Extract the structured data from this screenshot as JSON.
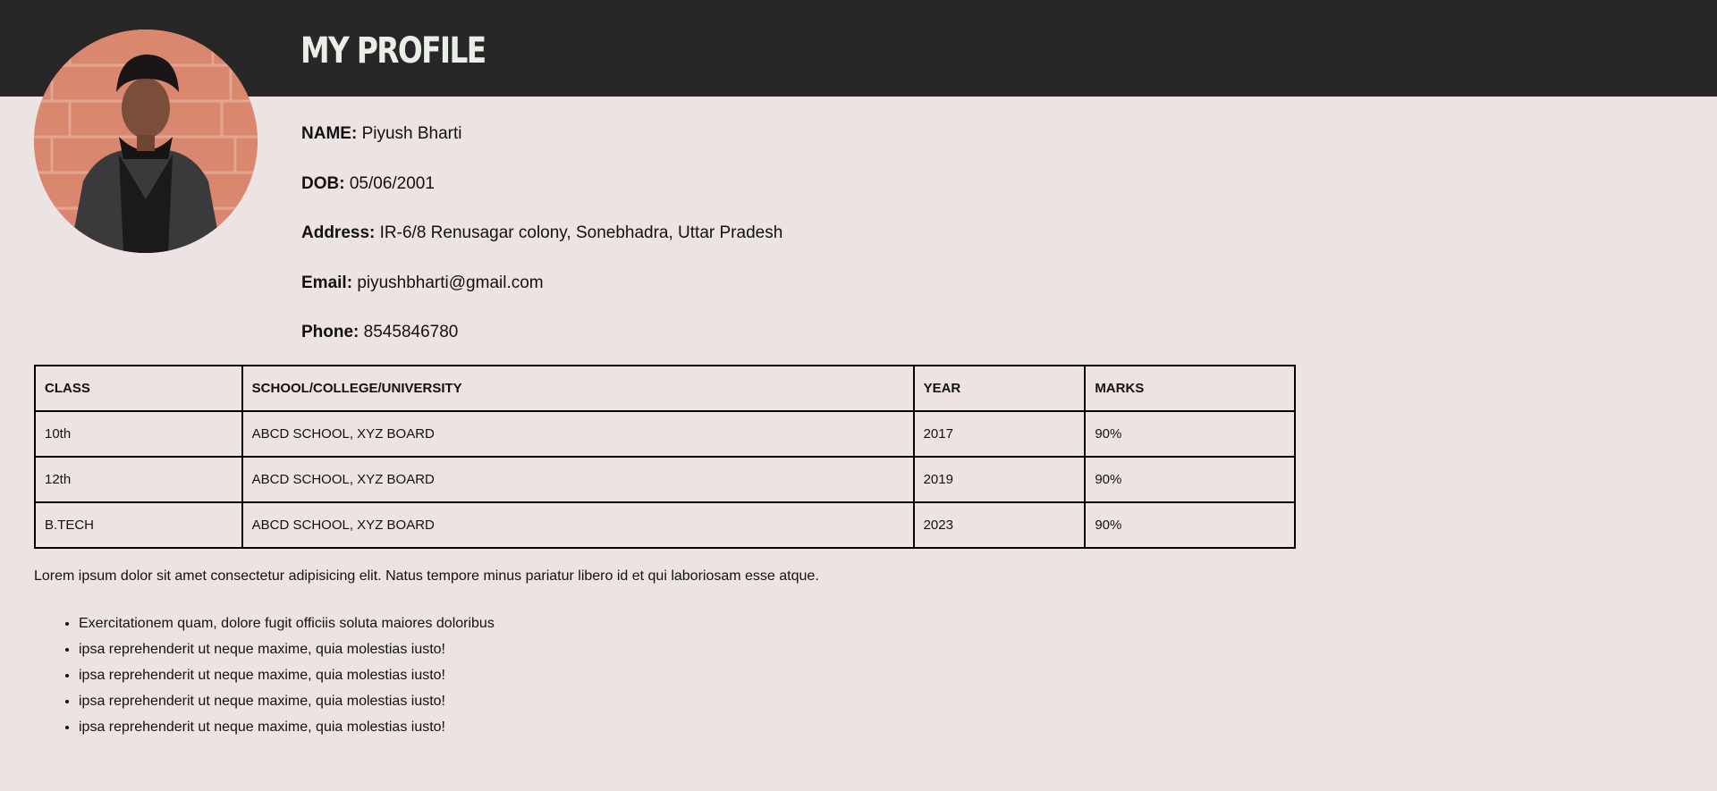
{
  "header": {
    "title": "MY PROFILE"
  },
  "avatar": {
    "alt": "profile photo"
  },
  "profile": {
    "name_label": "NAME:",
    "name": "Piyush Bharti",
    "dob_label": "DOB:",
    "dob": "05/06/2001",
    "address_label": "Address:",
    "address": "IR-6/8 Renusagar colony, Sonebhadra, Uttar Pradesh",
    "email_label": "Email:",
    "email": "piyushbharti@gmail.com",
    "phone_label": "Phone:",
    "phone": "8545846780"
  },
  "education": {
    "headers": [
      "CLASS",
      "SCHOOL/COLLEGE/UNIVERSITY",
      "YEAR",
      "MARKS"
    ],
    "rows": [
      [
        "10th",
        "ABCD SCHOOL, XYZ BOARD",
        "2017",
        "90%"
      ],
      [
        "12th",
        "ABCD SCHOOL, XYZ BOARD",
        "2019",
        "90%"
      ],
      [
        "B.TECH",
        "ABCD SCHOOL, XYZ BOARD",
        "2023",
        "90%"
      ]
    ]
  },
  "about": {
    "paragraph": "Lorem ipsum dolor sit amet consectetur adipisicing elit. Natus tempore minus pariatur libero id et qui laboriosam esse atque.",
    "bullets": [
      "Exercitationem quam, dolore fugit officiis soluta maiores doloribus",
      "ipsa reprehenderit ut neque maxime, quia molestias iusto!",
      "ipsa reprehenderit ut neque maxime, quia molestias iusto!",
      "ipsa reprehenderit ut neque maxime, quia molestias iusto!",
      "ipsa reprehenderit ut neque maxime, quia molestias iusto!"
    ]
  },
  "colors": {
    "header_bg": "#282627",
    "page_bg": "#ede3e3",
    "title_color": "#e9eee6"
  }
}
